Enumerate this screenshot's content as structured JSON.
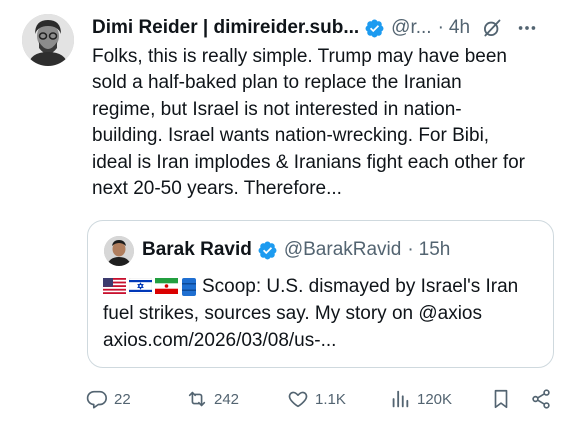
{
  "post": {
    "author_name": "Dimi Reider | dimireider.sub...",
    "handle": "@r...",
    "separator": "·",
    "time": "4h",
    "text": "Folks, this is really simple. Trump may have been\nsold  a half-baked plan to replace the Iranian\nregime, but Israel is not interested in nation-\nbuilding. Israel wants nation-wrecking. For Bibi,\nideal is Iran implodes & Iranians fight each other for\nnext 20-50 years. Therefore..."
  },
  "quote": {
    "author_name": "Barak Ravid",
    "handle": "@BarakRavid",
    "separator": "·",
    "time": "15h",
    "text_line1": "Scoop: U.S. dismayed by Israel's Iran",
    "text_line2": "fuel strikes, sources say. My story on @axios",
    "text_line3": "axios.com/2026/03/08/us-..."
  },
  "actions": {
    "replies": "22",
    "reposts": "242",
    "likes": "1.1K",
    "views": "120K"
  },
  "colors": {
    "verified": "#1d9bf0",
    "secondary_text": "#536471",
    "border": "#cfd9de"
  },
  "icons": [
    "verified-badge-icon",
    "grok-icon",
    "more-icon",
    "reply-icon",
    "repost-icon",
    "like-icon",
    "views-icon",
    "bookmark-icon",
    "share-icon",
    "flag-us-icon",
    "flag-israel-icon",
    "flag-iran-icon",
    "oil-barrel-icon"
  ]
}
